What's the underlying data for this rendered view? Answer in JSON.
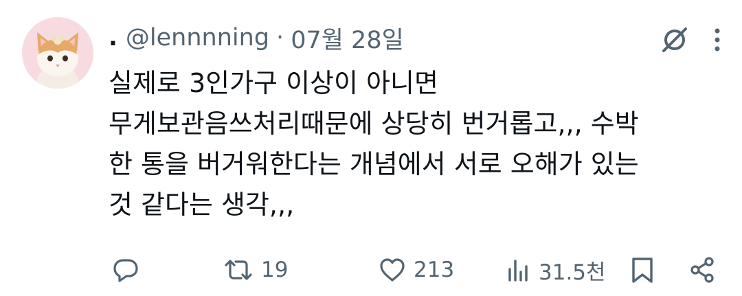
{
  "tweet": {
    "display_name": ".",
    "handle": "@lennnning",
    "separator": "·",
    "date": "07월 28일",
    "text_lines": [
      "실제로 3인가구 이상이 아니면",
      "무게보관음쓰처리때문에 상당히 번거롭고,,, 수박",
      "한 통을 버거워한다는 개념에서 서로 오해가 있는",
      "것 같다는 생각,,,"
    ]
  },
  "header_icons": [
    "grok-icon",
    "more-vertical-icon"
  ],
  "actions": {
    "reply": {
      "icon": "reply-icon",
      "count": ""
    },
    "retweet": {
      "icon": "retweet-icon",
      "count": "19"
    },
    "like": {
      "icon": "heart-icon",
      "count": "213"
    },
    "views": {
      "icon": "views-icon",
      "count": "31.5천"
    },
    "bookmark": {
      "icon": "bookmark-icon"
    },
    "share": {
      "icon": "share-icon"
    }
  },
  "colors": {
    "text": "#0f1419",
    "secondary": "#536471",
    "avatar_bg": "#f8dbe0"
  }
}
